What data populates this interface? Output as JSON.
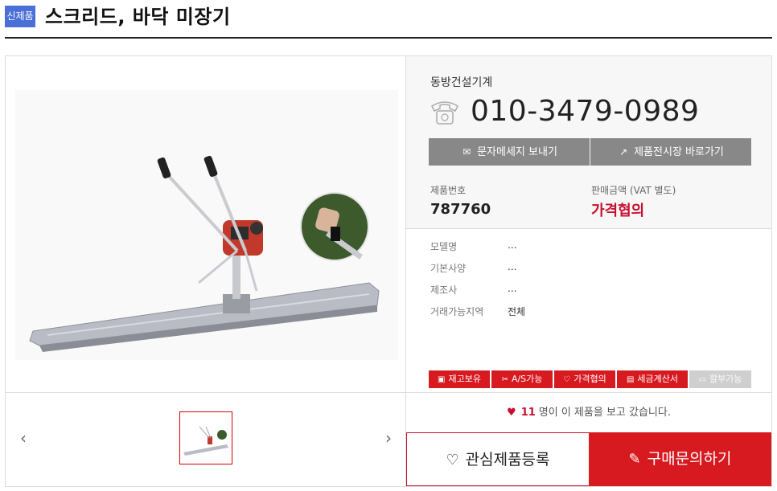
{
  "header": {
    "badge": "신제품",
    "title": "스크리드, 바닥 미장기"
  },
  "seller": {
    "company": "동방건설기계",
    "phone": "010-3479-0989"
  },
  "actions": {
    "sms_label": "문자메세지 보내기",
    "showroom_label": "제품전시장 바로가기"
  },
  "product": {
    "number_label": "제품번호",
    "number": "787760",
    "price_label": "판매금액 (VAT 별도)",
    "price": "가격협의"
  },
  "specs": [
    {
      "label": "모델명",
      "value": "..."
    },
    {
      "label": "기본사양",
      "value": "..."
    },
    {
      "label": "제조사",
      "value": "..."
    },
    {
      "label": "거래가능지역",
      "value": "전체"
    }
  ],
  "tags": [
    {
      "label": "재고보유",
      "icon": "box-icon",
      "active": true
    },
    {
      "label": "A/S가능",
      "icon": "tools-icon",
      "active": true
    },
    {
      "label": "가격협의",
      "icon": "handshake-icon",
      "active": true
    },
    {
      "label": "세금계산서",
      "icon": "receipt-icon",
      "active": true
    },
    {
      "label": "할부가능",
      "icon": "card-icon",
      "active": false
    }
  ],
  "views": {
    "count": "11",
    "suffix": "명이 이 제품을 보고 갔습니다."
  },
  "cta": {
    "wishlist_label": "관심제품등록",
    "inquiry_label": "구매문의하기"
  },
  "gallery": {
    "prev": "‹",
    "next": "›"
  },
  "colors": {
    "accent": "#d71920",
    "badge": "#4a6fd6",
    "button_gray": "#888888"
  }
}
